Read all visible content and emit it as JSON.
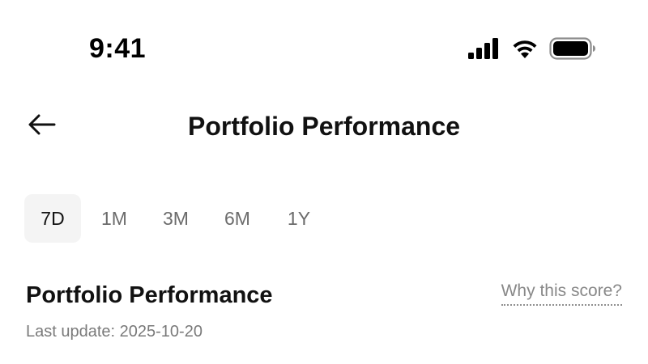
{
  "status_bar": {
    "time": "9:41",
    "icons": [
      "cellular-signal-icon",
      "wifi-icon",
      "battery-icon"
    ]
  },
  "header": {
    "title": "Portfolio Performance",
    "back_icon": "arrow-left-icon"
  },
  "period_tabs": {
    "items": [
      {
        "label": "7D",
        "active": true
      },
      {
        "label": "1M",
        "active": false
      },
      {
        "label": "3M",
        "active": false
      },
      {
        "label": "6M",
        "active": false
      },
      {
        "label": "1Y",
        "active": false
      }
    ]
  },
  "section": {
    "title": "Portfolio Performance",
    "why_link": "Why this score?",
    "last_update": "Last update: 2025-10-20"
  },
  "colors": {
    "background": "#ffffff",
    "text_primary": "#111111",
    "text_secondary": "#7a7a7a",
    "active_tab_bg": "#f4f4f4"
  }
}
